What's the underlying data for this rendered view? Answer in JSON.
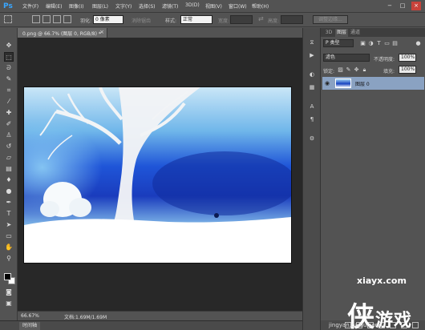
{
  "app": {
    "logo": "Ps"
  },
  "menu": [
    "文件(F)",
    "编辑(E)",
    "图像(I)",
    "图层(L)",
    "文字(Y)",
    "选择(S)",
    "滤镜(T)",
    "3D(D)",
    "视图(V)",
    "窗口(W)",
    "帮助(H)"
  ],
  "window_controls": {
    "minimize": "−",
    "maximize": "□",
    "close": "×"
  },
  "options": {
    "feather_label": "羽化:",
    "feather_value": "0 像素",
    "antialias_label": "消除锯齿",
    "style_label": "样式:",
    "style_value": "正常",
    "width_label": "宽度:",
    "height_label": "高度:",
    "refine_edge": "调整边缘..."
  },
  "document": {
    "tab_label": "0.png @ 66.7% (图层 0, RGB/8) *",
    "close": "×"
  },
  "status": {
    "zoom": "66.67%",
    "doc_info": "文档:1.69M/1.69M"
  },
  "timeline": {
    "label": "时间轴"
  },
  "panel": {
    "tabs": [
      "3D",
      "图层",
      "通道"
    ],
    "filter_kind": "P 类型",
    "blend_mode": "滤色",
    "opacity_label": "不透明度:",
    "opacity_value": "100%",
    "lock_label": "锁定:",
    "fill_label": "填充:",
    "fill_value": "100%",
    "layer_name": "图层 0"
  },
  "watermark": {
    "site": "xiayx.com",
    "brand_glyph": "侠",
    "brand_text": "游戏",
    "url": "jingyan.baidu.com"
  },
  "icons": {
    "tools": [
      "move-icon",
      "marquee-icon",
      "lasso-icon",
      "quick-select-icon",
      "crop-icon",
      "eyedropper-icon",
      "healing-icon",
      "brush-icon",
      "clone-stamp-icon",
      "history-brush-icon",
      "eraser-icon",
      "gradient-icon",
      "blur-icon",
      "dodge-icon",
      "pen-icon",
      "type-icon",
      "path-select-icon",
      "shape-icon",
      "hand-icon",
      "zoom-icon"
    ],
    "dock": [
      "history-icon",
      "actions-icon",
      "color-icon",
      "swatches-icon",
      "character-icon",
      "paragraph-icon",
      "adjust-icon"
    ]
  },
  "colors": {
    "accent": "#39a6ff",
    "selected_layer": "#8aa2c2",
    "canvas_bg": "#282828"
  }
}
